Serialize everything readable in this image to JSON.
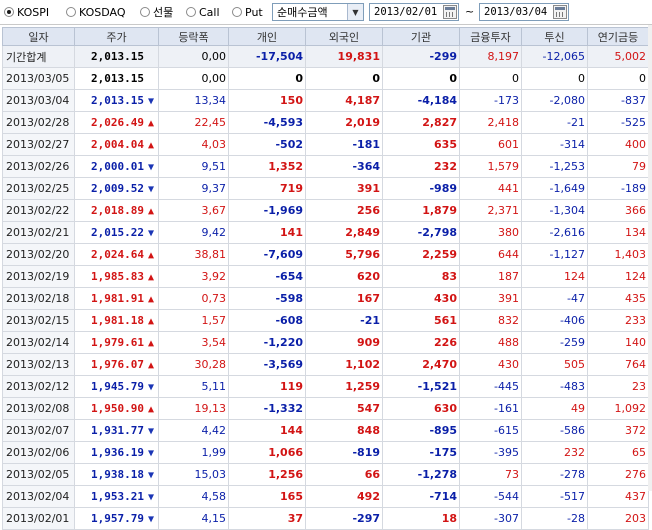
{
  "toolbar": {
    "radios": [
      {
        "label": "KOSPI",
        "checked": true
      },
      {
        "label": "KOSDAQ",
        "checked": false
      },
      {
        "label": "선물",
        "checked": false
      },
      {
        "label": "Call",
        "checked": false
      },
      {
        "label": "Put",
        "checked": false
      }
    ],
    "select_value": "순매수금액",
    "date_from": "2013/02/01",
    "date_sep": "~",
    "date_to": "2013/03/04"
  },
  "table": {
    "headers": [
      "일자",
      "주가",
      "등락폭",
      "개인",
      "외국인",
      "기관",
      "금융투자",
      "투신",
      "연기금등"
    ],
    "summary": {
      "date": "기간합계",
      "price": "2,013.15",
      "change": "0,00",
      "retail": "-17,504",
      "foreign": "19,831",
      "inst": "-299",
      "fin": "8,197",
      "trust": "-12,065",
      "pension": "5,002"
    },
    "rows": [
      {
        "date": "2013/03/05",
        "price": "2,013.15",
        "dir": "",
        "change": "0,00",
        "retail": "0",
        "foreign": "0",
        "inst": "0",
        "fin": "0",
        "trust": "0",
        "pension": "0"
      },
      {
        "date": "2013/03/04",
        "price": "2,013.15",
        "dir": "down",
        "change": "13,34",
        "retail": "150",
        "foreign": "4,187",
        "inst": "-4,184",
        "fin": "-173",
        "trust": "-2,080",
        "pension": "-837"
      },
      {
        "date": "2013/02/28",
        "price": "2,026.49",
        "dir": "up",
        "change": "22,45",
        "retail": "-4,593",
        "foreign": "2,019",
        "inst": "2,827",
        "fin": "2,418",
        "trust": "-21",
        "pension": "-525"
      },
      {
        "date": "2013/02/27",
        "price": "2,004.04",
        "dir": "up",
        "change": "4,03",
        "retail": "-502",
        "foreign": "-181",
        "inst": "635",
        "fin": "601",
        "trust": "-314",
        "pension": "400"
      },
      {
        "date": "2013/02/26",
        "price": "2,000.01",
        "dir": "down",
        "change": "9,51",
        "retail": "1,352",
        "foreign": "-364",
        "inst": "232",
        "fin": "1,579",
        "trust": "-1,253",
        "pension": "79"
      },
      {
        "date": "2013/02/25",
        "price": "2,009.52",
        "dir": "down",
        "change": "9,37",
        "retail": "719",
        "foreign": "391",
        "inst": "-989",
        "fin": "441",
        "trust": "-1,649",
        "pension": "-189"
      },
      {
        "date": "2013/02/22",
        "price": "2,018.89",
        "dir": "up",
        "change": "3,67",
        "retail": "-1,969",
        "foreign": "256",
        "inst": "1,879",
        "fin": "2,371",
        "trust": "-1,304",
        "pension": "366"
      },
      {
        "date": "2013/02/21",
        "price": "2,015.22",
        "dir": "down",
        "change": "9,42",
        "retail": "141",
        "foreign": "2,849",
        "inst": "-2,798",
        "fin": "380",
        "trust": "-2,616",
        "pension": "134"
      },
      {
        "date": "2013/02/20",
        "price": "2,024.64",
        "dir": "up",
        "change": "38,81",
        "retail": "-7,609",
        "foreign": "5,796",
        "inst": "2,259",
        "fin": "644",
        "trust": "-1,127",
        "pension": "1,403"
      },
      {
        "date": "2013/02/19",
        "price": "1,985.83",
        "dir": "up",
        "change": "3,92",
        "retail": "-654",
        "foreign": "620",
        "inst": "83",
        "fin": "187",
        "trust": "124",
        "pension": "124"
      },
      {
        "date": "2013/02/18",
        "price": "1,981.91",
        "dir": "up",
        "change": "0,73",
        "retail": "-598",
        "foreign": "167",
        "inst": "430",
        "fin": "391",
        "trust": "-47",
        "pension": "435"
      },
      {
        "date": "2013/02/15",
        "price": "1,981.18",
        "dir": "up",
        "change": "1,57",
        "retail": "-608",
        "foreign": "-21",
        "inst": "561",
        "fin": "832",
        "trust": "-406",
        "pension": "233"
      },
      {
        "date": "2013/02/14",
        "price": "1,979.61",
        "dir": "up",
        "change": "3,54",
        "retail": "-1,220",
        "foreign": "909",
        "inst": "226",
        "fin": "488",
        "trust": "-259",
        "pension": "140"
      },
      {
        "date": "2013/02/13",
        "price": "1,976.07",
        "dir": "up",
        "change": "30,28",
        "retail": "-3,569",
        "foreign": "1,102",
        "inst": "2,470",
        "fin": "430",
        "trust": "505",
        "pension": "764"
      },
      {
        "date": "2013/02/12",
        "price": "1,945.79",
        "dir": "down",
        "change": "5,11",
        "retail": "119",
        "foreign": "1,259",
        "inst": "-1,521",
        "fin": "-445",
        "trust": "-483",
        "pension": "23"
      },
      {
        "date": "2013/02/08",
        "price": "1,950.90",
        "dir": "up",
        "change": "19,13",
        "retail": "-1,332",
        "foreign": "547",
        "inst": "630",
        "fin": "-161",
        "trust": "49",
        "pension": "1,092"
      },
      {
        "date": "2013/02/07",
        "price": "1,931.77",
        "dir": "down",
        "change": "4,42",
        "retail": "144",
        "foreign": "848",
        "inst": "-895",
        "fin": "-615",
        "trust": "-586",
        "pension": "372"
      },
      {
        "date": "2013/02/06",
        "price": "1,936.19",
        "dir": "down",
        "change": "1,99",
        "retail": "1,066",
        "foreign": "-819",
        "inst": "-175",
        "fin": "-395",
        "trust": "232",
        "pension": "65"
      },
      {
        "date": "2013/02/05",
        "price": "1,938.18",
        "dir": "down",
        "change": "15,03",
        "retail": "1,256",
        "foreign": "66",
        "inst": "-1,278",
        "fin": "73",
        "trust": "-278",
        "pension": "276"
      },
      {
        "date": "2013/02/04",
        "price": "1,953.21",
        "dir": "down",
        "change": "4,58",
        "retail": "165",
        "foreign": "492",
        "inst": "-714",
        "fin": "-544",
        "trust": "-517",
        "pension": "437"
      },
      {
        "date": "2013/02/01",
        "price": "1,957.79",
        "dir": "down",
        "change": "4,15",
        "retail": "37",
        "foreign": "-297",
        "inst": "18",
        "fin": "-307",
        "trust": "-28",
        "pension": "203"
      }
    ]
  },
  "colors": {
    "up": "#d21414",
    "down": "#0a1fa8",
    "header_bg": "#dfe6f2"
  }
}
